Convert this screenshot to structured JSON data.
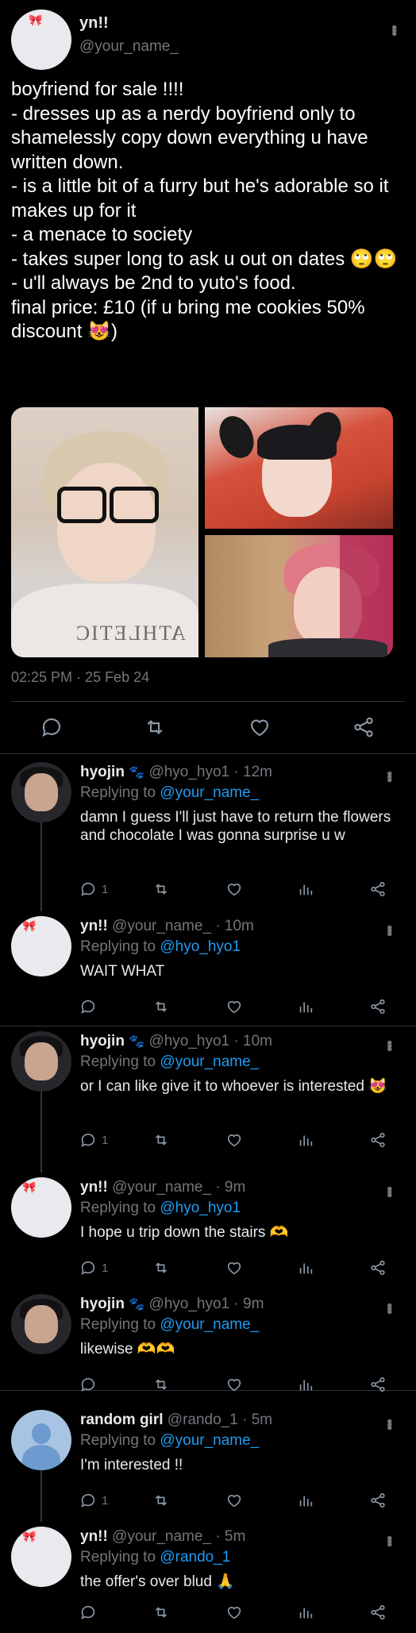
{
  "main_tweet": {
    "display_name": "yn!!",
    "handle": "@your_name_",
    "text": "boyfriend for sale !!!!\n- dresses up as a nerdy boyfriend only to shamelessly copy down everything u have written down.\n- is a little bit of a furry but he's adorable so it makes up for it\n- a menace to society\n- takes super long to ask u out on dates 🙄🙄\n- u'll always be 2nd to yuto's food.\nfinal price: £10 (if u bring me cookies 50% discount 😻)",
    "timestamp": "02:25 PM · 25 Feb 24"
  },
  "replies": [
    {
      "display_name": "hyojin",
      "badge": "🐾",
      "handle": "@hyo_hyo1",
      "time": "· 12m",
      "replying_to_prefix": "Replying to",
      "replying_to": "@your_name_",
      "text": "damn I guess I'll just have to return the flowers and chocolate I was gonna surprise u w",
      "reply_count": "1"
    },
    {
      "display_name": "yn!!",
      "badge": "",
      "handle": "@your_name_",
      "time": "· 10m",
      "replying_to_prefix": "Replying to",
      "replying_to": "@hyo_hyo1",
      "text": "WAIT WHAT",
      "reply_count": ""
    },
    {
      "display_name": "hyojin",
      "badge": "🐾",
      "handle": "@hyo_hyo1",
      "time": "· 10m",
      "replying_to_prefix": "Replying to",
      "replying_to": "@your_name_",
      "text": "or I can like give it to whoever is interested 😻",
      "reply_count": "1"
    },
    {
      "display_name": "yn!!",
      "badge": "",
      "handle": "@your_name_",
      "time": "· 9m",
      "replying_to_prefix": "Replying to",
      "replying_to": "@hyo_hyo1",
      "text": "I hope u trip down the stairs 🫶",
      "reply_count": "1"
    },
    {
      "display_name": "hyojin",
      "badge": "🐾",
      "handle": "@hyo_hyo1",
      "time": "· 9m",
      "replying_to_prefix": "Replying to",
      "replying_to": "@your_name_",
      "text": "likewise 🫶🫶",
      "reply_count": ""
    },
    {
      "display_name": "random girl",
      "badge": "",
      "handle": "@rando_1",
      "time": "· 5m",
      "replying_to_prefix": "Replying to",
      "replying_to": "@your_name_",
      "text": "I'm interested !!",
      "reply_count": "1"
    },
    {
      "display_name": "yn!!",
      "badge": "",
      "handle": "@your_name_",
      "time": "· 5m",
      "replying_to_prefix": "Replying to",
      "replying_to": "@rando_1",
      "text": "the offer's over blud 🙏",
      "reply_count": ""
    }
  ],
  "icons": {
    "reply": "reply-icon",
    "retweet": "retweet-icon",
    "like": "heart-icon",
    "views": "views-icon",
    "share": "share-icon",
    "more": "more-icon"
  },
  "colors": {
    "background": "#000000",
    "text": "#e7e9ea",
    "muted": "#71767b",
    "link": "#1d9bf0",
    "separator": "#2f3336"
  }
}
